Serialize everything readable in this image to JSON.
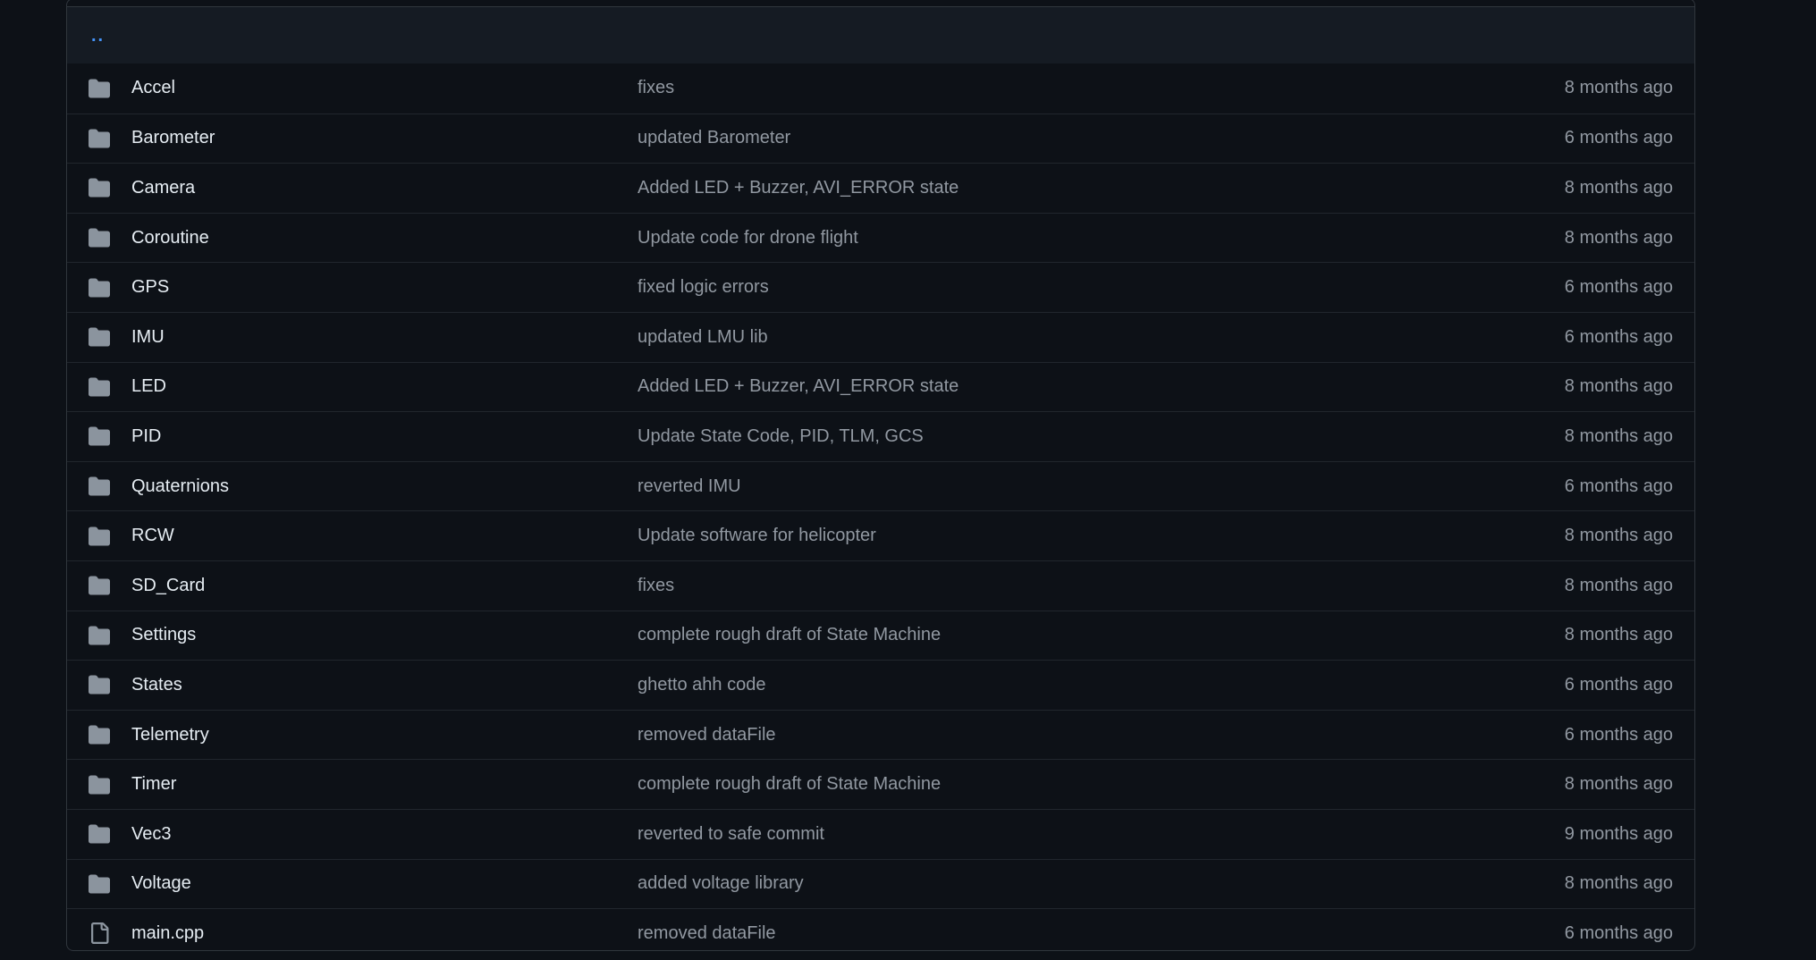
{
  "parent_link": "..",
  "colors": {
    "background": "#0d1117",
    "row_header": "#151b23",
    "border": "#30363d",
    "link": "#4493f8",
    "text": "#e6edf3",
    "muted": "#9198a1",
    "icon": "#8b949e"
  },
  "rows": [
    {
      "icon": "folder-icon",
      "name": "Accel",
      "message": "fixes",
      "age": "8 months ago"
    },
    {
      "icon": "folder-icon",
      "name": "Barometer",
      "message": "updated Barometer",
      "age": "6 months ago"
    },
    {
      "icon": "folder-icon",
      "name": "Camera",
      "message": "Added LED + Buzzer, AVI_ERROR state",
      "age": "8 months ago"
    },
    {
      "icon": "folder-icon",
      "name": "Coroutine",
      "message": "Update code for drone flight",
      "age": "8 months ago"
    },
    {
      "icon": "folder-icon",
      "name": "GPS",
      "message": "fixed logic errors",
      "age": "6 months ago"
    },
    {
      "icon": "folder-icon",
      "name": "IMU",
      "message": "updated LMU lib",
      "age": "6 months ago"
    },
    {
      "icon": "folder-icon",
      "name": "LED",
      "message": "Added LED + Buzzer, AVI_ERROR state",
      "age": "8 months ago"
    },
    {
      "icon": "folder-icon",
      "name": "PID",
      "message": "Update State Code, PID, TLM, GCS",
      "age": "8 months ago"
    },
    {
      "icon": "folder-icon",
      "name": "Quaternions",
      "message": "reverted IMU",
      "age": "6 months ago"
    },
    {
      "icon": "folder-icon",
      "name": "RCW",
      "message": "Update software for helicopter",
      "age": "8 months ago"
    },
    {
      "icon": "folder-icon",
      "name": "SD_Card",
      "message": "fixes",
      "age": "8 months ago"
    },
    {
      "icon": "folder-icon",
      "name": "Settings",
      "message": "complete rough draft of State Machine",
      "age": "8 months ago"
    },
    {
      "icon": "folder-icon",
      "name": "States",
      "message": "ghetto ahh code",
      "age": "6 months ago"
    },
    {
      "icon": "folder-icon",
      "name": "Telemetry",
      "message": "removed dataFile",
      "age": "6 months ago"
    },
    {
      "icon": "folder-icon",
      "name": "Timer",
      "message": "complete rough draft of State Machine",
      "age": "8 months ago"
    },
    {
      "icon": "folder-icon",
      "name": "Vec3",
      "message": "reverted to safe commit",
      "age": "9 months ago"
    },
    {
      "icon": "folder-icon",
      "name": "Voltage",
      "message": "added voltage library",
      "age": "8 months ago"
    },
    {
      "icon": "file-icon",
      "name": "main.cpp",
      "message": "removed dataFile",
      "age": "6 months ago"
    }
  ]
}
